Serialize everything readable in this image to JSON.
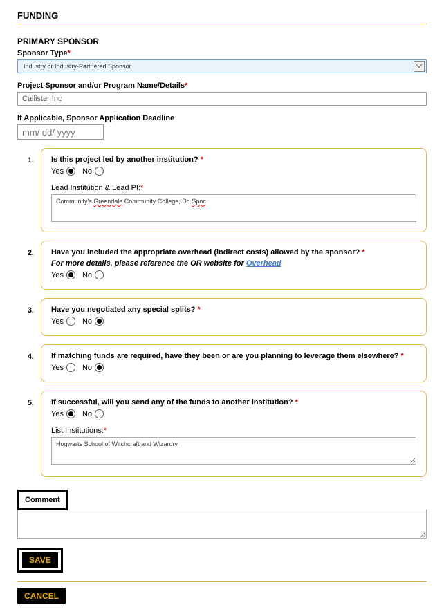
{
  "section_title": "FUNDING",
  "primary_sponsor": {
    "title": "PRIMARY SPONSOR",
    "sponsor_type_label": "Sponsor Type",
    "sponsor_type_value": "Industry or Industry-Partnered Sponsor",
    "project_sponsor_label": "Project Sponsor and/or Program Name/Details",
    "project_sponsor_value": "Callister Inc",
    "deadline_label": "If Applicable, Sponsor Application Deadline",
    "deadline_placeholder": "mm/ dd/ yyyy"
  },
  "questions": [
    {
      "num": "1.",
      "text": "Is this project led by another institution? ",
      "yes_label": "Yes",
      "no_label": "No",
      "selected": "yes",
      "subfield_label": "Lead Institution & Lead PI:",
      "subfield_value_prefix": "Community's ",
      "subfield_value_err1": "Greendale",
      "subfield_value_mid": " Community College, Dr. ",
      "subfield_value_err2": "Spoc"
    },
    {
      "num": "2.",
      "text": "Have you included the appropriate overhead (indirect costs) allowed by the sponsor? ",
      "note_prefix": "For more details, please reference the OR website for ",
      "note_link": "Overhead",
      "yes_label": "Yes",
      "no_label": "No",
      "selected": "yes"
    },
    {
      "num": "3.",
      "text": "Have you negotiated any special splits? ",
      "yes_label": "Yes",
      "no_label": "No",
      "selected": "no"
    },
    {
      "num": "4.",
      "text": "If matching funds are required, have they been or are you planning to leverage them elsewhere? ",
      "yes_label": "Yes",
      "no_label": "No",
      "selected": "no"
    },
    {
      "num": "5.",
      "text": "If successful, will you send any of the funds to another institution? ",
      "yes_label": "Yes",
      "no_label": "No",
      "selected": "yes",
      "subfield_label": "List Institutions:",
      "subfield_value": "Hogwarts School of Witchcraft and Wizardry"
    }
  ],
  "comment_label": "Comment",
  "save_label": "SAVE",
  "cancel_label": "CANCEL"
}
